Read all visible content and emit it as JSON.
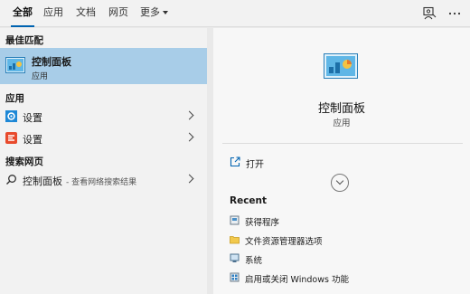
{
  "tabs": [
    {
      "label": "全部",
      "active": true
    },
    {
      "label": "应用"
    },
    {
      "label": "文档"
    },
    {
      "label": "网页"
    },
    {
      "label": "更多"
    }
  ],
  "sections": {
    "best_match": "最佳匹配",
    "apps": "应用",
    "web": "搜索网页"
  },
  "best_match": {
    "title": "控制面板",
    "subtitle": "应用",
    "icon": "control-panel-icon"
  },
  "apps": [
    {
      "label": "设置",
      "icon": "gear-icon"
    },
    {
      "label": "设置",
      "icon": "gear-alt-icon"
    }
  ],
  "web": {
    "label": "控制面板",
    "hint": "- 查看网络搜索结果",
    "icon": "search-icon"
  },
  "detail": {
    "title": "控制面板",
    "subtitle": "应用",
    "open_label": "打开",
    "recent_heading": "Recent",
    "recent": [
      {
        "label": "获得程序",
        "icon": "program-icon"
      },
      {
        "label": "文件资源管理器选项",
        "icon": "folder-options-icon"
      },
      {
        "label": "系统",
        "icon": "system-icon"
      },
      {
        "label": "启用或关闭 Windows 功能",
        "icon": "windows-features-icon"
      }
    ]
  },
  "colors": {
    "accent": "#0063b1",
    "selected": "#a8cde8"
  }
}
